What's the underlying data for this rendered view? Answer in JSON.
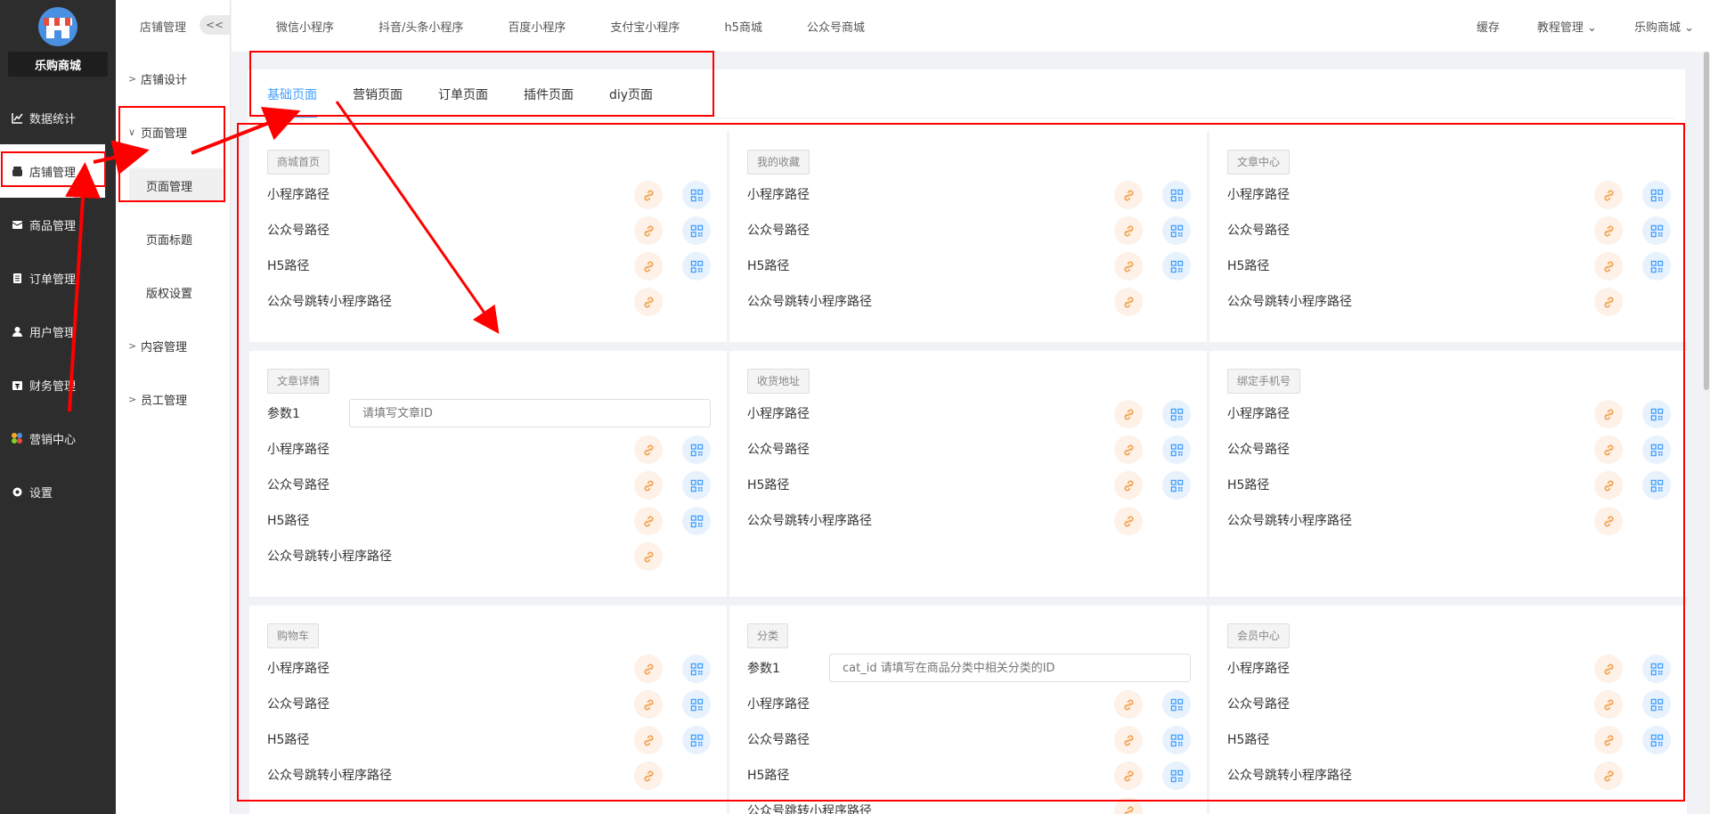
{
  "app": {
    "shop_name": "乐购商城"
  },
  "main_nav": [
    {
      "label": "数据统计",
      "icon": "chart-icon"
    },
    {
      "label": "店铺管理",
      "icon": "store-icon"
    },
    {
      "label": "商品管理",
      "icon": "goods-icon"
    },
    {
      "label": "订单管理",
      "icon": "order-icon"
    },
    {
      "label": "用户管理",
      "icon": "user-icon"
    },
    {
      "label": "财务管理",
      "icon": "finance-icon"
    },
    {
      "label": "营销中心",
      "icon": "marketing-icon"
    },
    {
      "label": "设置",
      "icon": "gear-icon"
    }
  ],
  "sub_sidebar": {
    "title": "店铺管理",
    "collapse_label": "<<",
    "items": [
      {
        "label": "店铺设计"
      },
      {
        "label": "页面管理"
      },
      {
        "label": "页面管理"
      },
      {
        "label": "页面标题"
      },
      {
        "label": "版权设置"
      },
      {
        "label": "内容管理"
      },
      {
        "label": "员工管理"
      }
    ]
  },
  "top_tabs": [
    "微信小程序",
    "抖音/头条小程序",
    "百度小程序",
    "支付宝小程序",
    "h5商城",
    "公众号商城"
  ],
  "top_right": {
    "cache": "缓存",
    "tutorial": "教程管理",
    "shop": "乐购商城"
  },
  "page_tabs": [
    "基础页面",
    "营销页面",
    "订单页面",
    "插件页面",
    "diy页面"
  ],
  "labels": {
    "mini": "小程序路径",
    "mp": "公众号路径",
    "h5": "H5路径",
    "jump": "公众号跳转小程序路径",
    "param": "参数1"
  },
  "cards": [
    {
      "title": "商城首页"
    },
    {
      "title": "我的收藏"
    },
    {
      "title": "文章中心"
    },
    {
      "title": "文章详情",
      "param_placeholder": "请填写文章ID"
    },
    {
      "title": "收货地址"
    },
    {
      "title": "绑定手机号"
    },
    {
      "title": "购物车"
    },
    {
      "title": "分类",
      "param_placeholder": "cat_id 请填写在商品分类中相关分类的ID"
    },
    {
      "title": "会员中心"
    }
  ],
  "colors": {
    "sidebar_bg": "#2d2d2d",
    "accent": "#409eff",
    "link_orange": "#f39c43",
    "annotation_red": "#ff0000"
  }
}
